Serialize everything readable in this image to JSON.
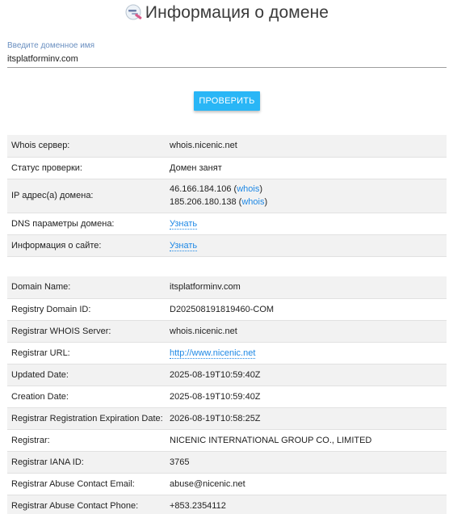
{
  "page": {
    "title": "Информация о домене"
  },
  "form": {
    "label": "Введите доменное имя",
    "domain_value": "itsplatforminv.com",
    "check_button": "ПРОВЕРИТЬ"
  },
  "summary": {
    "whois_server": {
      "key": "Whois сервер:",
      "value": "whois.nicenic.net"
    },
    "status": {
      "key": "Статус проверки:",
      "value": "Домен занят"
    },
    "ip": {
      "key": "IP адрес(а) домена:",
      "addresses": [
        {
          "ip": "46.166.184.106",
          "link": "whois"
        },
        {
          "ip": "185.206.180.138",
          "link": "whois"
        }
      ]
    },
    "dns": {
      "key": "DNS параметры домена:",
      "link": "Узнать"
    },
    "site_info": {
      "key": "Информация о сайте:",
      "link": "Узнать"
    }
  },
  "whois": {
    "domain_name": {
      "key": "Domain Name:",
      "value": "itsplatforminv.com"
    },
    "registry_domain_id": {
      "key": "Registry Domain ID:",
      "value": "D202508191819460-COM"
    },
    "registrar_whois_server": {
      "key": "Registrar WHOIS Server:",
      "value": "whois.nicenic.net"
    },
    "registrar_url": {
      "key": "Registrar URL:",
      "value": "http://www.nicenic.net"
    },
    "updated_date": {
      "key": "Updated Date:",
      "value": "2025-08-19T10:59:40Z"
    },
    "creation_date": {
      "key": "Creation Date:",
      "value": "2025-08-19T10:59:40Z"
    },
    "expiration_date": {
      "key": "Registrar Registration Expiration Date:",
      "value": "2026-08-19T10:58:25Z"
    },
    "registrar": {
      "key": "Registrar:",
      "value": "NICENIC INTERNATIONAL GROUP CO., LIMITED"
    },
    "iana_id": {
      "key": "Registrar IANA ID:",
      "value": "3765"
    },
    "abuse_email": {
      "key": "Registrar Abuse Contact Email:",
      "value": "abuse@nicenic.net"
    },
    "abuse_phone": {
      "key": "Registrar Abuse Contact Phone:",
      "value": "+853.2354112"
    }
  },
  "colors": {
    "accent": "#29b6f6",
    "link": "#1e88e5",
    "row_alt": "#f2f2f2"
  },
  "icons": {
    "logo": "magnifier-globe-icon"
  }
}
